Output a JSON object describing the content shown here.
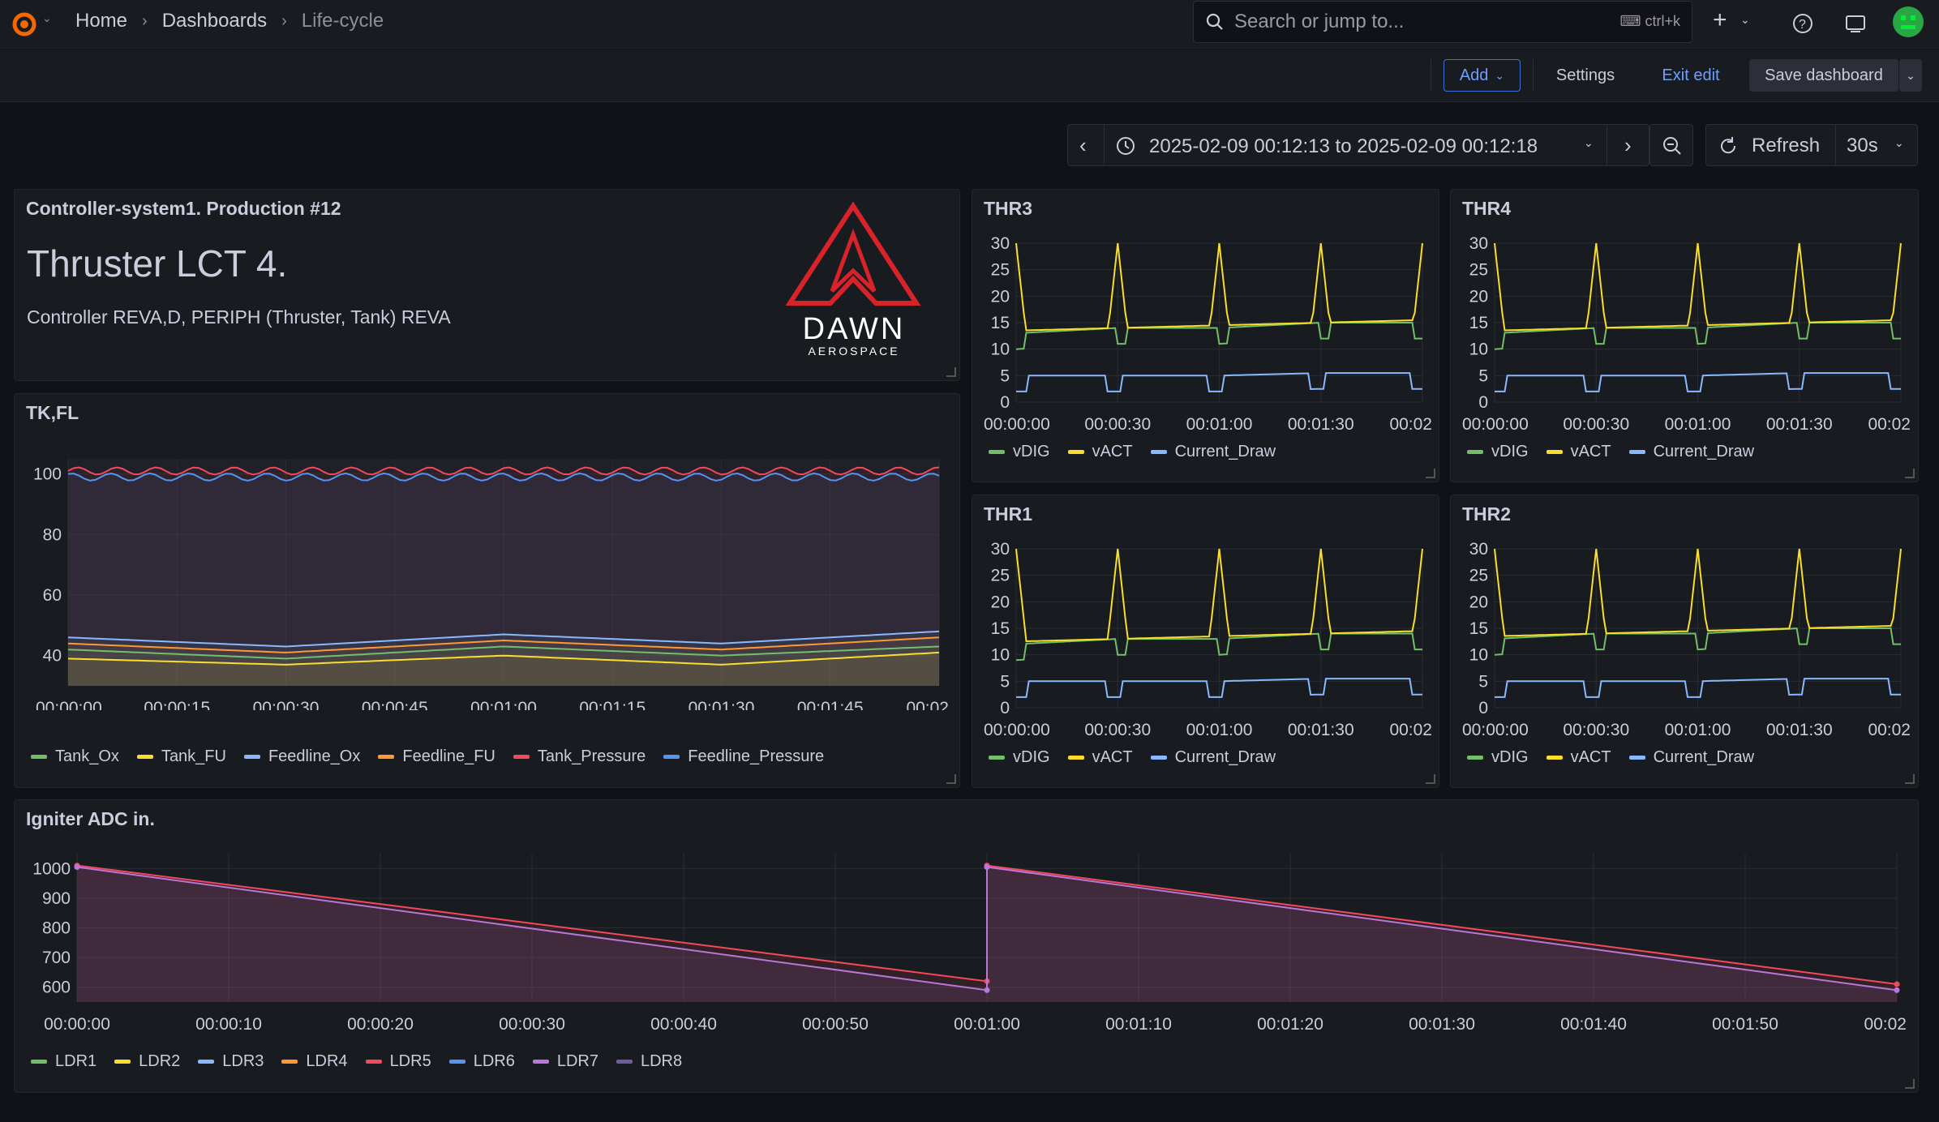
{
  "nav": {
    "home": "Home",
    "dashboards": "Dashboards",
    "current": "Life-cycle",
    "search_placeholder": "Search or jump to...",
    "shortcut": "ctrl+k"
  },
  "toolbar": {
    "add": "Add",
    "settings": "Settings",
    "exit_edit": "Exit edit",
    "save": "Save dashboard"
  },
  "timepicker": {
    "range": "2025-02-09 00:12:13 to 2025-02-09 00:12:18",
    "refresh": "Refresh",
    "interval": "30s"
  },
  "text_panel": {
    "title": "Controller-system1. Production #12",
    "heading": "Thruster LCT 4.",
    "subtitle": "Controller REVA,D, PERIPH (Thruster, Tank) REVA",
    "logo_text": "DAWN",
    "logo_sub": "AEROSPACE"
  },
  "panels": {
    "tkfl": {
      "title": "TK,FL",
      "yticks": [
        "100",
        "80",
        "60",
        "40"
      ],
      "xticks": [
        "00:00:00",
        "00:00:15",
        "00:00:30",
        "00:00:45",
        "00:01:00",
        "00:01:15",
        "00:01:30",
        "00:01:45",
        "00:02"
      ],
      "legend": [
        {
          "name": "Tank_Ox",
          "color": "#73bf69"
        },
        {
          "name": "Tank_FU",
          "color": "#fade2a"
        },
        {
          "name": "Feedline_Ox",
          "color": "#8ab8ff"
        },
        {
          "name": "Feedline_FU",
          "color": "#ff9830"
        },
        {
          "name": "Tank_Pressure",
          "color": "#f2495c"
        },
        {
          "name": "Feedline_Pressure",
          "color": "#5794f2"
        }
      ]
    },
    "thr3": {
      "title": "THR3"
    },
    "thr4": {
      "title": "THR4"
    },
    "thr1": {
      "title": "THR1"
    },
    "thr2": {
      "title": "THR2"
    },
    "thr_axes": {
      "yticks": [
        "30",
        "25",
        "20",
        "15",
        "10",
        "5",
        "0"
      ],
      "xticks": [
        "00:00:00",
        "00:00:30",
        "00:01:00",
        "00:01:30",
        "00:02"
      ],
      "legend": [
        {
          "name": "vDIG",
          "color": "#73bf69"
        },
        {
          "name": "vACT",
          "color": "#fade2a"
        },
        {
          "name": "Current_Draw",
          "color": "#8ab8ff"
        }
      ]
    },
    "igniter": {
      "title": "Igniter ADC in.",
      "yticks": [
        "1000",
        "900",
        "800",
        "700",
        "600"
      ],
      "xticks": [
        "00:00:00",
        "00:00:10",
        "00:00:20",
        "00:00:30",
        "00:00:40",
        "00:00:50",
        "00:01:00",
        "00:01:10",
        "00:01:20",
        "00:01:30",
        "00:01:40",
        "00:01:50",
        "00:02"
      ],
      "legend": [
        {
          "name": "LDR1",
          "color": "#73bf69"
        },
        {
          "name": "LDR2",
          "color": "#fade2a"
        },
        {
          "name": "LDR3",
          "color": "#8ab8ff"
        },
        {
          "name": "LDR4",
          "color": "#ff9830"
        },
        {
          "name": "LDR5",
          "color": "#f2495c"
        },
        {
          "name": "LDR6",
          "color": "#5794f2"
        },
        {
          "name": "LDR7",
          "color": "#b877d9"
        },
        {
          "name": "LDR8",
          "color": "#705da0"
        }
      ]
    }
  },
  "chart_data": [
    {
      "type": "line",
      "title": "TK,FL",
      "x": [
        "00:00:00",
        "00:00:30",
        "00:01:00",
        "00:01:30",
        "00:02"
      ],
      "ylim": [
        30,
        105
      ],
      "series": [
        {
          "name": "Tank_Pressure",
          "values": [
            101,
            101,
            101,
            101,
            101
          ]
        },
        {
          "name": "Feedline_Pressure",
          "values": [
            99,
            99,
            99,
            99,
            99
          ]
        },
        {
          "name": "Feedline_Ox",
          "values": [
            46,
            43,
            47,
            44,
            48
          ]
        },
        {
          "name": "Feedline_FU",
          "values": [
            44,
            41,
            45,
            42,
            46
          ]
        },
        {
          "name": "Tank_Ox",
          "values": [
            42,
            39,
            43,
            40,
            43
          ]
        },
        {
          "name": "Tank_FU",
          "values": [
            39,
            37,
            40,
            37,
            41
          ]
        }
      ]
    },
    {
      "type": "line",
      "title": "THR3",
      "x": [
        "00:00:00",
        "00:00:30",
        "00:01:00",
        "00:01:30",
        "00:02"
      ],
      "ylim": [
        0,
        30
      ],
      "series": [
        {
          "name": "vDIG",
          "values": [
            13,
            14,
            14,
            15,
            15
          ]
        },
        {
          "name": "vACT",
          "values": [
            13.5,
            14,
            14.5,
            15,
            15.5
          ]
        },
        {
          "name": "Current_Draw",
          "values": [
            5,
            5,
            5,
            5.5,
            5.5
          ]
        }
      ]
    },
    {
      "type": "line",
      "title": "THR4",
      "x": [
        "00:00:00",
        "00:00:30",
        "00:01:00",
        "00:01:30",
        "00:02"
      ],
      "ylim": [
        0,
        30
      ],
      "series": [
        {
          "name": "vDIG",
          "values": [
            13,
            14,
            14,
            15,
            15
          ]
        },
        {
          "name": "vACT",
          "values": [
            13.5,
            14,
            14.5,
            15,
            15.5
          ]
        },
        {
          "name": "Current_Draw",
          "values": [
            5,
            5,
            5,
            5.5,
            5.5
          ]
        }
      ]
    },
    {
      "type": "line",
      "title": "THR1",
      "x": [
        "00:00:00",
        "00:00:30",
        "00:01:00",
        "00:01:30",
        "00:02"
      ],
      "ylim": [
        0,
        30
      ],
      "series": [
        {
          "name": "vDIG",
          "values": [
            12,
            13,
            13,
            14,
            14
          ]
        },
        {
          "name": "vACT",
          "values": [
            12.5,
            13,
            13.5,
            14,
            14.5
          ]
        },
        {
          "name": "Current_Draw",
          "values": [
            5,
            5,
            5,
            5.5,
            5.5
          ]
        }
      ]
    },
    {
      "type": "line",
      "title": "THR2",
      "x": [
        "00:00:00",
        "00:00:30",
        "00:01:00",
        "00:01:30",
        "00:02"
      ],
      "ylim": [
        0,
        30
      ],
      "series": [
        {
          "name": "vDIG",
          "values": [
            13,
            14,
            14,
            15,
            15
          ]
        },
        {
          "name": "vACT",
          "values": [
            13.5,
            14,
            14.5,
            15,
            15.5
          ]
        },
        {
          "name": "Current_Draw",
          "values": [
            5,
            5,
            5,
            5.5,
            5.5
          ]
        }
      ]
    },
    {
      "type": "area",
      "title": "Igniter ADC in.",
      "x": [
        "00:00:00",
        "00:01:00",
        "00:01:00",
        "00:02"
      ],
      "ylim": [
        550,
        1050
      ],
      "series": [
        {
          "name": "LDR5",
          "values": [
            1010,
            620,
            1010,
            610
          ]
        },
        {
          "name": "LDR7",
          "values": [
            1005,
            590,
            1005,
            590
          ]
        }
      ]
    }
  ]
}
